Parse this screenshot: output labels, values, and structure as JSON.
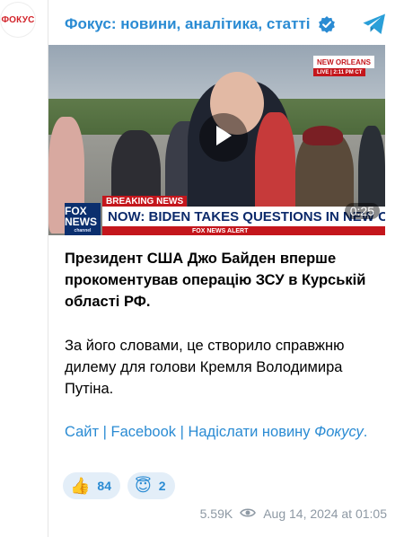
{
  "channel": {
    "avatar_text": "ФОКУС",
    "name": "Фокус: новини, аналітика, статті",
    "verified_icon": "verified-badge-icon",
    "telegram_icon": "telegram-icon",
    "brand_color": "#2a8bd3"
  },
  "video": {
    "location_label": "NEW ORLEANS",
    "location_sub": "LIVE | 2:11 PM CT",
    "breaking_label": "BREAKING NEWS",
    "headline": "NOW: BIDEN TAKES QUESTIONS IN NEW ORLEANS",
    "alert_label": "FOX NEWS ALERT",
    "network_logo": "FOX NEWS",
    "network_sub": "channel",
    "duration": "0:25",
    "play_icon": "play-icon"
  },
  "post": {
    "headline": "Президент США Джо Байден вперше прокоментував операцію ЗСУ в Курській області РФ.",
    "body": "За його словами, це створило справжню дилему для голови Кремля Володимира Путіна.",
    "link_site": "Сайт",
    "link_sep": " | ",
    "link_facebook": "Facebook",
    "link_sep2": " | ",
    "link_submit": "Надіслати новину ",
    "link_submit_italic": "Фокусу",
    "link_end": "."
  },
  "reactions": [
    {
      "emoji": "👍",
      "count": "84"
    },
    {
      "emoji": "😇",
      "count": "2"
    }
  ],
  "meta": {
    "views": "5.59K",
    "views_icon": "eye-icon",
    "timestamp": "Aug 14, 2024 at 01:05"
  }
}
